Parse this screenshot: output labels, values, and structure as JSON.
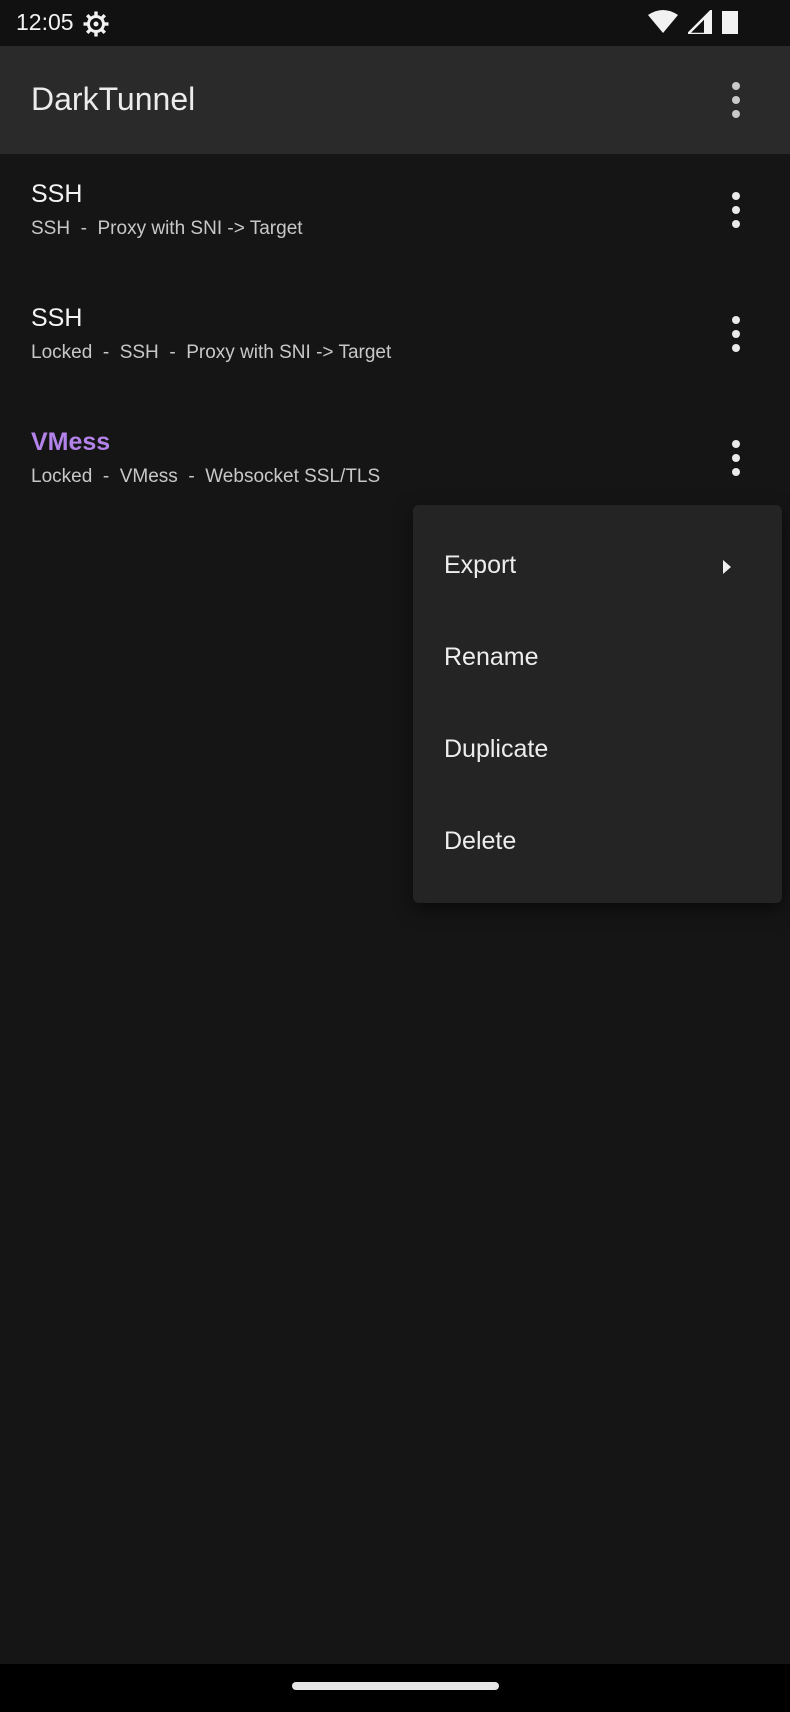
{
  "status_bar": {
    "time": "12:05",
    "icons": [
      "settings-gear-icon",
      "wifi-icon",
      "cellular-signal-icon",
      "battery-icon"
    ]
  },
  "app_bar": {
    "title": "DarkTunnel",
    "overflow_icon": "more-vert-icon"
  },
  "profiles": [
    {
      "title": "SSH",
      "subtitle": "SSH  -  Proxy with SNI -> Target",
      "selected": false
    },
    {
      "title": "SSH",
      "subtitle": "Locked  -  SSH  -  Proxy with SNI -> Target",
      "selected": false
    },
    {
      "title": "VMess",
      "subtitle": "Locked  -  VMess  -  Websocket SSL/TLS",
      "selected": true
    }
  ],
  "context_menu": {
    "items": [
      {
        "label": "Export",
        "has_submenu": true
      },
      {
        "label": "Rename",
        "has_submenu": false
      },
      {
        "label": "Duplicate",
        "has_submenu": false
      },
      {
        "label": "Delete",
        "has_submenu": false
      }
    ]
  },
  "colors": {
    "background": "#151516",
    "app_bar": "#2a2a2b",
    "accent": "#b383e9",
    "menu_background": "#242425"
  }
}
